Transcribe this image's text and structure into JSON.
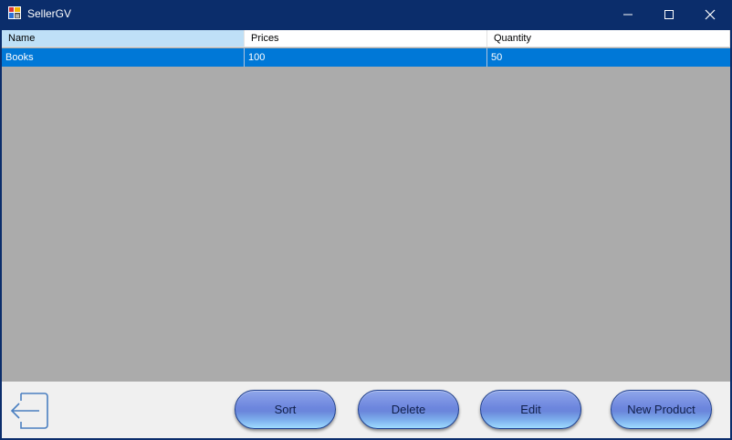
{
  "window": {
    "title": "SellerGV"
  },
  "grid": {
    "columns": [
      "Name",
      "Prices",
      "Quantity"
    ],
    "rows": [
      {
        "name": "Books",
        "price": "100",
        "quantity": "50"
      }
    ]
  },
  "footer": {
    "sort_label": "Sort",
    "delete_label": "Delete",
    "edit_label": "Edit",
    "new_product_label": "New Product"
  },
  "colors": {
    "title_bar": "#0b2d6b",
    "selection": "#0078d7",
    "grid_background": "#ababab"
  }
}
